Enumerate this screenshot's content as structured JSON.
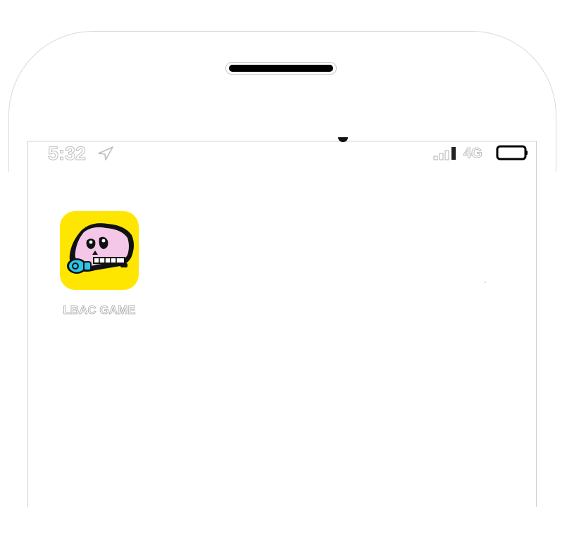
{
  "status_bar": {
    "time": "5:32",
    "location_icon": "location-arrow-icon",
    "signal_icon": "signal-bars-icon",
    "network": "4G",
    "battery_icon": "battery-icon"
  },
  "home_screen": {
    "apps": [
      {
        "label": "LBAC GAME",
        "icon": "bored-ape-skull-pacifier-icon",
        "background_color": "#ffe600"
      }
    ]
  },
  "colors": {
    "app_tile_yellow": "#ffe600",
    "skull_pink": "#f4c6e8",
    "pacifier_blue": "#2ec4e8"
  }
}
